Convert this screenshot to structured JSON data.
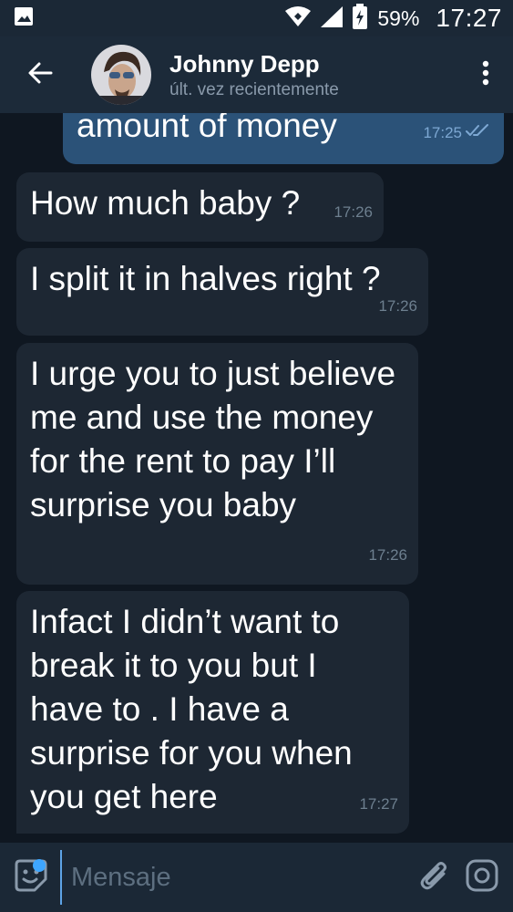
{
  "status_bar": {
    "battery_percent": "59%",
    "time": "17:27",
    "icons": [
      "image-icon",
      "wifi-icon",
      "signal-icon",
      "battery-charging-icon"
    ]
  },
  "header": {
    "contact_name": "Johnny Depp",
    "contact_status": "últ. vez recientemente",
    "icons": [
      "back-arrow-icon",
      "avatar",
      "more-vert-icon"
    ]
  },
  "messages": [
    {
      "direction": "out",
      "text": "amount of money",
      "time": "17:25",
      "read": true
    },
    {
      "direction": "in",
      "text": "How much baby ?",
      "time": "17:26"
    },
    {
      "direction": "in",
      "text": "I split it in halves right ?",
      "time": "17:26"
    },
    {
      "direction": "in",
      "text": "I urge you to just believe me and use the money for the rent to pay I’ll surprise you baby",
      "time": "17:26"
    },
    {
      "direction": "in",
      "text": "Infact I didn’t want to break it to you but I have to . I have a surprise for you when you get here",
      "time": "17:27"
    }
  ],
  "input": {
    "placeholder": "Mensaje",
    "value": "",
    "icons": [
      "emoji-icon",
      "attach-icon",
      "camera-icon"
    ]
  },
  "colors": {
    "background": "#0f1721",
    "header": "#1c2a39",
    "incoming_bubble": "#1d2733",
    "outgoing_bubble": "#2b5278",
    "accent": "#3ea6ff"
  }
}
